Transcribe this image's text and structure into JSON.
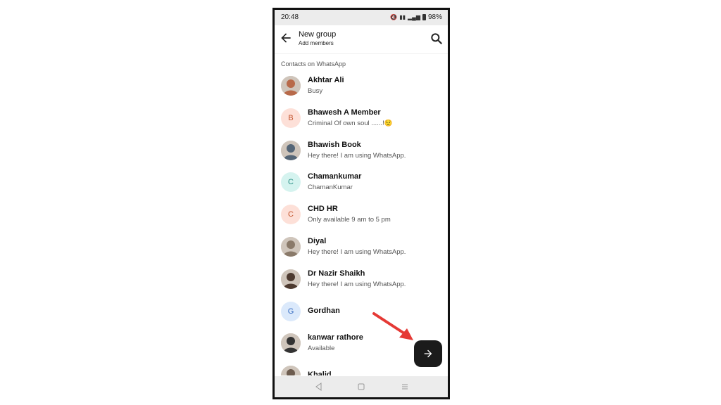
{
  "status_bar": {
    "time": "20:48",
    "battery": "98%"
  },
  "header": {
    "title": "New group",
    "subtitle": "Add members"
  },
  "section_label": "Contacts on WhatsApp",
  "contacts": [
    {
      "name": "Akhtar Ali",
      "status": "Busy",
      "avatar": "photo",
      "color": "#b86a4a"
    },
    {
      "name": "Bhawesh A Member",
      "status": "Criminal Of own soul ......!😟",
      "avatar": "B",
      "color": "#fde0d8",
      "fg": "#c4552f"
    },
    {
      "name": "Bhawish Book",
      "status": "Hey there! I am using WhatsApp.",
      "avatar": "photo",
      "color": "#556677"
    },
    {
      "name": "Chamankumar",
      "status": "ChamanKumar",
      "avatar": "C",
      "color": "#d5f3ef",
      "fg": "#2a8f85"
    },
    {
      "name": "CHD HR",
      "status": "Only available 9 am to 5 pm",
      "avatar": "C",
      "color": "#fde0d8",
      "fg": "#c4552f"
    },
    {
      "name": "Diyal",
      "status": "Hey there! I am using WhatsApp.",
      "avatar": "photo",
      "color": "#8a7a6a"
    },
    {
      "name": "Dr Nazir Shaikh",
      "status": "Hey there! I am using WhatsApp.",
      "avatar": "photo",
      "color": "#4d3a30"
    },
    {
      "name": "Gordhan",
      "status": "",
      "avatar": "G",
      "color": "#dbe9fb",
      "fg": "#3a6fc2"
    },
    {
      "name": "kanwar rathore",
      "status": "Available",
      "avatar": "photo",
      "color": "#333333"
    },
    {
      "name": "Khalid",
      "status": "",
      "avatar": "photo",
      "color": "#6d5c4f"
    }
  ],
  "icons": {
    "back": "back-arrow-icon",
    "search": "search-icon",
    "fab": "next-arrow-icon"
  },
  "colors": {
    "fab": "#1b1b1b",
    "annotation_arrow": "#e53935"
  }
}
